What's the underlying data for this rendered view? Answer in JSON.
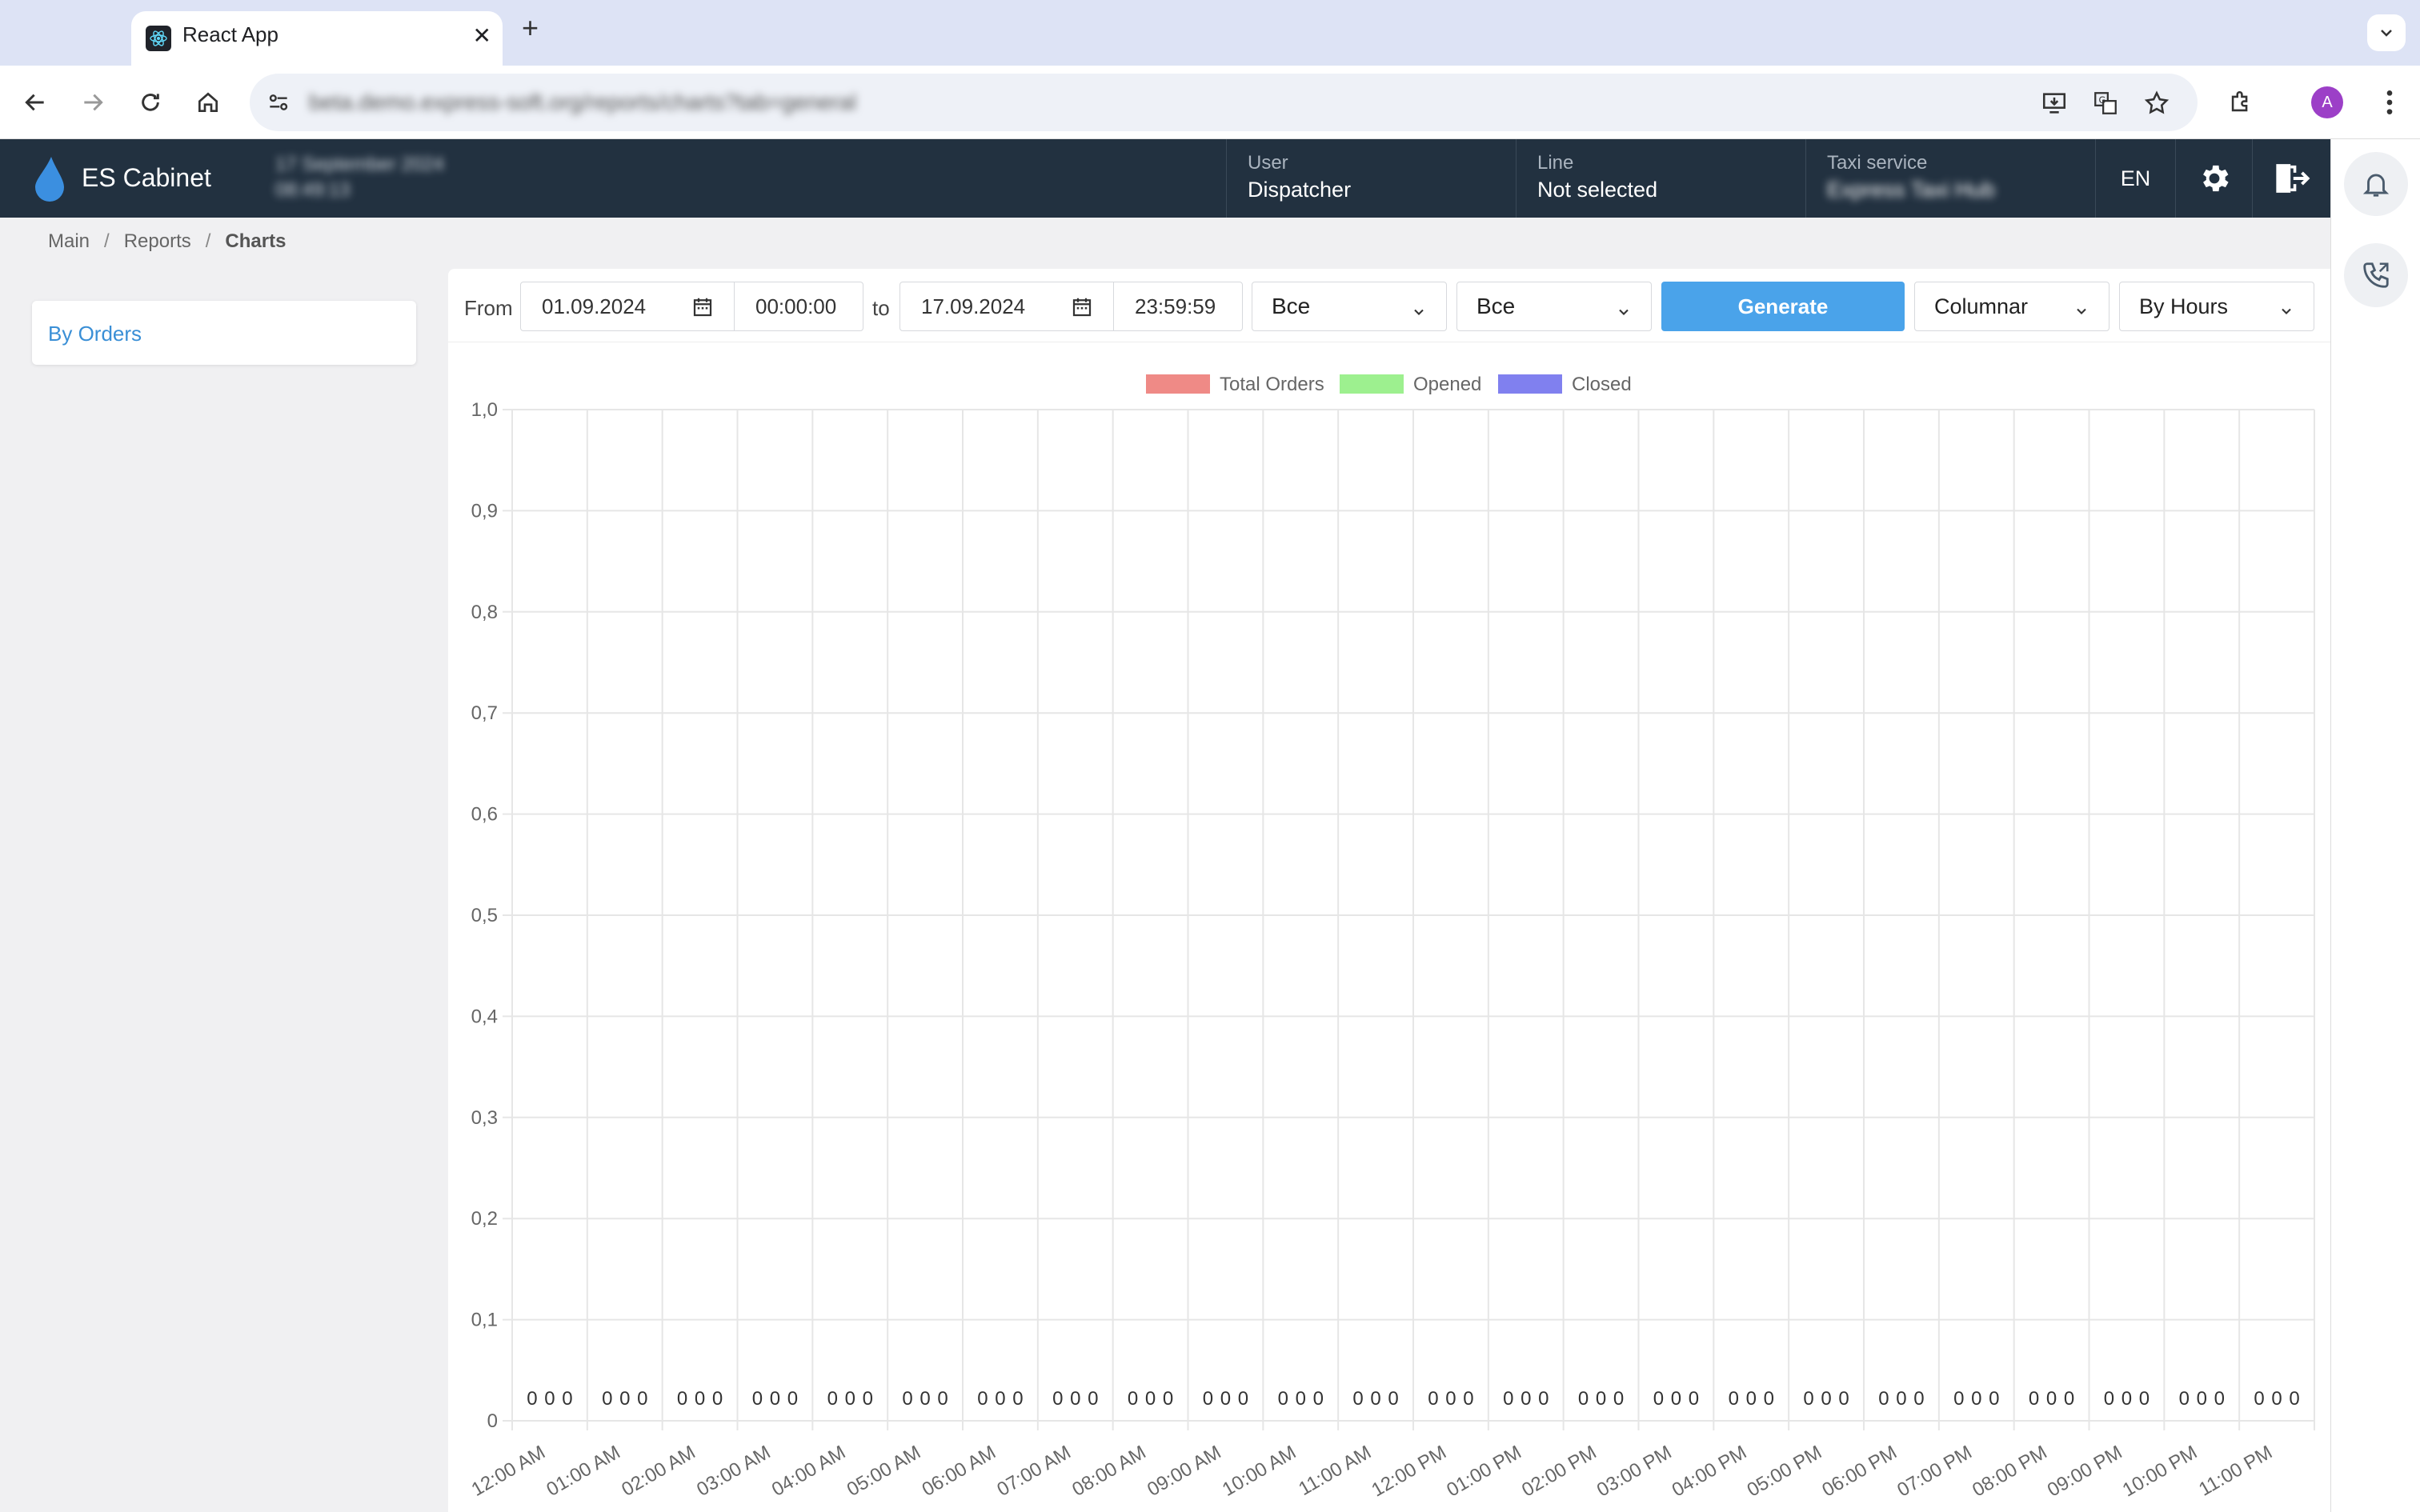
{
  "browser": {
    "tab_title": "React App",
    "url": "beta.demo.express-soft.org/reports/charts?tab=general"
  },
  "app": {
    "name": "ES Cabinet",
    "date_line1": "17 September 2024",
    "date_line2": "08:49:13"
  },
  "header": {
    "user_label": "User",
    "user_value": "Dispatcher",
    "line_label": "Line",
    "line_value": "Not selected",
    "taxi_label": "Taxi service",
    "taxi_value": "Express Taxi Hub",
    "language": "EN"
  },
  "breadcrumb": {
    "main": "Main",
    "reports": "Reports",
    "current": "Charts"
  },
  "sidebar": {
    "items": [
      {
        "label": "By Orders"
      }
    ]
  },
  "filters": {
    "from_label": "From",
    "from_date": "01.09.2024",
    "from_time": "00:00:00",
    "to_label": "to",
    "to_date": "17.09.2024",
    "to_time": "23:59:59",
    "select1": "Все",
    "select2": "Все",
    "generate_label": "Generate",
    "chart_type": "Columnar",
    "grouping": "By Hours"
  },
  "colors": {
    "total_orders": "#ef8a86",
    "opened": "#9df08f",
    "closed": "#8080ef",
    "accent": "#4aa3ea",
    "header_bg": "#223140"
  },
  "chart_data": {
    "type": "bar",
    "categories": [
      "12:00 AM",
      "01:00 AM",
      "02:00 AM",
      "03:00 AM",
      "04:00 AM",
      "05:00 AM",
      "06:00 AM",
      "07:00 AM",
      "08:00 AM",
      "09:00 AM",
      "10:00 AM",
      "11:00 AM",
      "12:00 PM",
      "01:00 PM",
      "02:00 PM",
      "03:00 PM",
      "04:00 PM",
      "05:00 PM",
      "06:00 PM",
      "07:00 PM",
      "08:00 PM",
      "09:00 PM",
      "10:00 PM",
      "11:00 PM"
    ],
    "series": [
      {
        "name": "Total Orders",
        "values": [
          0,
          0,
          0,
          0,
          0,
          0,
          0,
          0,
          0,
          0,
          0,
          0,
          0,
          0,
          0,
          0,
          0,
          0,
          0,
          0,
          0,
          0,
          0,
          0
        ]
      },
      {
        "name": "Opened",
        "values": [
          0,
          0,
          0,
          0,
          0,
          0,
          0,
          0,
          0,
          0,
          0,
          0,
          0,
          0,
          0,
          0,
          0,
          0,
          0,
          0,
          0,
          0,
          0,
          0
        ]
      },
      {
        "name": "Closed",
        "values": [
          0,
          0,
          0,
          0,
          0,
          0,
          0,
          0,
          0,
          0,
          0,
          0,
          0,
          0,
          0,
          0,
          0,
          0,
          0,
          0,
          0,
          0,
          0,
          0
        ]
      }
    ],
    "y_ticks": [
      "0",
      "0,1",
      "0,2",
      "0,3",
      "0,4",
      "0,5",
      "0,6",
      "0,7",
      "0,8",
      "0,9",
      "1,0"
    ],
    "ylim": [
      0,
      1
    ],
    "legend_position": "top-center",
    "grid": true
  }
}
